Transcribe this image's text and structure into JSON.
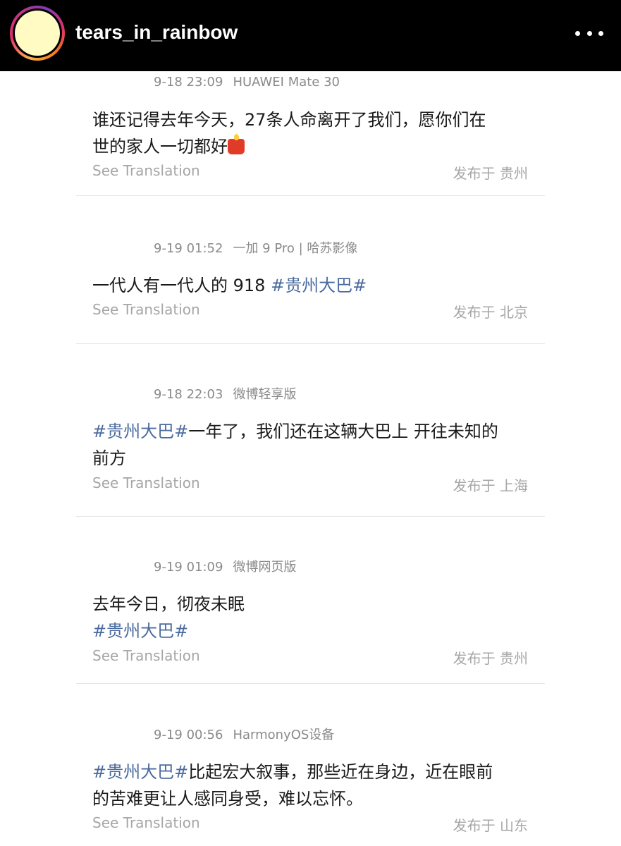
{
  "header": {
    "username": "tears_in_rainbow"
  },
  "posts": [
    {
      "time": "9-18 23:09",
      "device": "HUAWEI Mate 30",
      "line1": "谁还记得去年今天，27条人命离开了我们，愿你们在",
      "line2": "世的家人一切都好",
      "emoji": "candle-icon",
      "translate": "See Translation",
      "location": "发布于 贵州"
    },
    {
      "time": "9-19 01:52",
      "device": "一加 9 Pro | 哈苏影像",
      "text": "一代人有一代人的 918 ",
      "tag": "#贵州大巴#",
      "translate": "See Translation",
      "location": "发布于 北京"
    },
    {
      "time": "9-18 22:03",
      "device": "微博轻享版",
      "tag": "#贵州大巴#",
      "text": "一年了，我们还在这辆大巴上 开往未知的",
      "line2": "前方",
      "translate": "See Translation",
      "location": "发布于 上海"
    },
    {
      "time": "9-19 01:09",
      "device": "微博网页版",
      "text": "去年今日，彻夜未眠",
      "tag": "#贵州大巴#",
      "translate": "See Translation",
      "location": "发布于 贵州"
    },
    {
      "time": "9-19 00:56",
      "device": "HarmonyOS设备",
      "tag": "#贵州大巴#",
      "text": "比起宏大叙事，那些近在身边，近在眼前",
      "line2": "的苦难更让人感同身受，难以忘怀。",
      "translate": "See Translation",
      "location": "发布于 山东"
    }
  ]
}
